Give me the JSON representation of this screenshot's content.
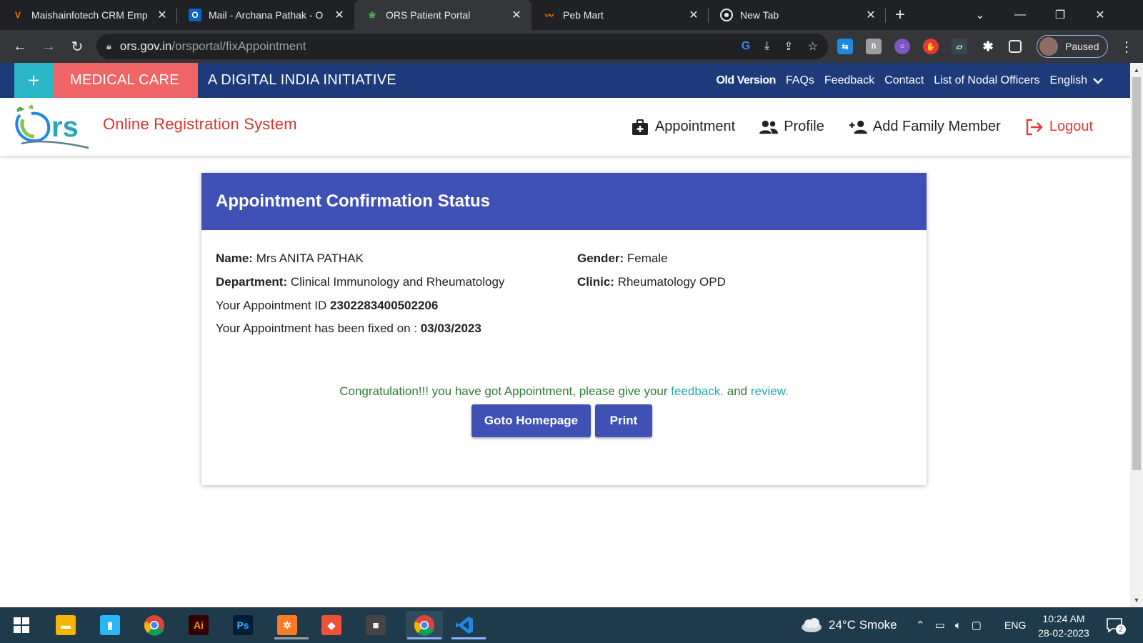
{
  "browser": {
    "tabs": [
      {
        "title": "Maishainfotech CRM Emp",
        "icon": "maisha-favicon",
        "active": false
      },
      {
        "title": "Mail - Archana Pathak - O",
        "icon": "outlook-favicon",
        "active": false
      },
      {
        "title": "ORS Patient Portal",
        "icon": "ors-favicon",
        "active": true
      },
      {
        "title": "Peb Mart",
        "icon": "pebmart-favicon",
        "active": false
      },
      {
        "title": "New Tab",
        "icon": "chrome-favicon",
        "active": false
      }
    ],
    "url_host": "ors.gov.in",
    "url_path": "/orsportal/fixAppointment",
    "profile_status": "Paused"
  },
  "topbar": {
    "plus": "+",
    "medical_care": "MEDICAL CARE",
    "initiative": "A DIGITAL INDIA INITIATIVE",
    "links": {
      "old_version": "Old Version",
      "faqs": "FAQs",
      "feedback": "Feedback",
      "contact": "Contact",
      "nodal_officers": "List of Nodal Officers",
      "language": "English"
    }
  },
  "header": {
    "brand": "Online Registration System",
    "logo_text": "rs",
    "nav": {
      "appointment": "Appointment",
      "profile": "Profile",
      "add_family": "Add Family Member",
      "logout": "Logout"
    }
  },
  "card": {
    "title": "Appointment Confirmation Status",
    "name_label": "Name:",
    "name_value": "Mrs ANITA PATHAK",
    "gender_label": "Gender:",
    "gender_value": "Female",
    "department_label": "Department:",
    "department_value": "Clinical Immunology and Rheumatology",
    "clinic_label": "Clinic:",
    "clinic_value": "Rheumatology OPD",
    "appointment_id_text": "Your Appointment ID",
    "appointment_id": "2302283400502206",
    "fixed_on_text": "Your Appointment has been fixed on :",
    "fixed_on_date": "03/03/2023",
    "congrats_text": "Congratulation!!! you have got Appointment, please give your",
    "feedback_link": "feedback.",
    "and_text": "and",
    "review_link": "review.",
    "goto_home_button": "Goto Homepage",
    "print_button": "Print"
  },
  "taskbar": {
    "weather": "24°C  Smoke",
    "language": "ENG",
    "time": "10:24 AM",
    "date": "28-02-2023",
    "notifications": "2",
    "apps": [
      "start-icon",
      "file-explorer-icon",
      "notepad-icon",
      "chrome-icon",
      "illustrator-icon",
      "photoshop-icon",
      "xampp-icon",
      "git-icon",
      "app-icon",
      "chrome-active-icon",
      "vscode-icon"
    ]
  },
  "colors": {
    "topbar_bg": "#1d3a7a",
    "medical_care_bg": "#f06566",
    "plus_bg": "#2bb7c7",
    "card_header": "#3f51b5",
    "brand_red": "#d9342b",
    "congrats_green": "#2e7d32",
    "link_teal": "#26a6b9"
  }
}
